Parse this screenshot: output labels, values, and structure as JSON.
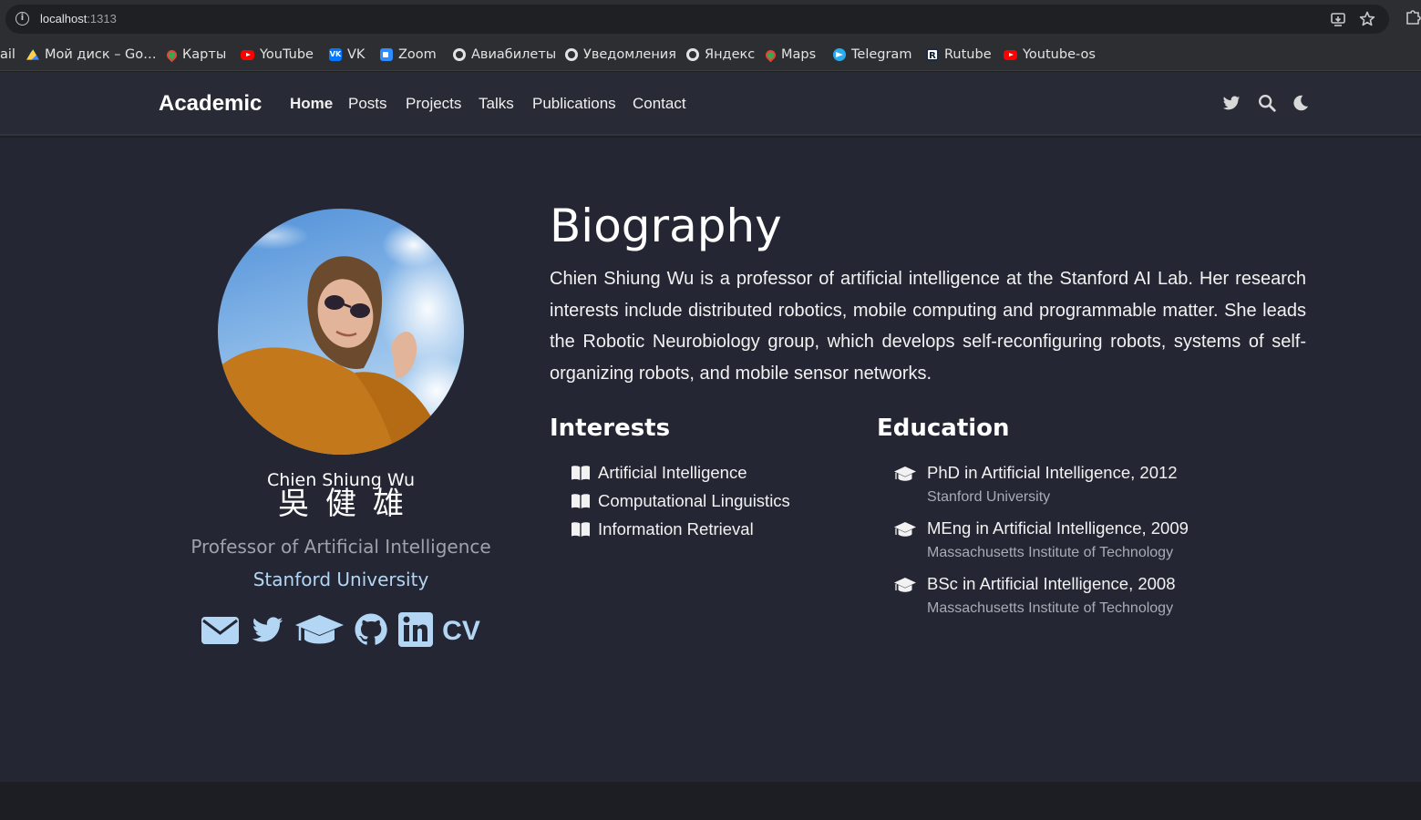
{
  "browser": {
    "url_host": "localhost",
    "url_port": ":1313",
    "bookmarks": [
      {
        "label": "ail",
        "icon": "none"
      },
      {
        "label": "Мой диск – Go…",
        "icon": "google-drive-icon"
      },
      {
        "label": "Карты",
        "icon": "google-maps-icon"
      },
      {
        "label": "YouTube",
        "icon": "youtube-icon"
      },
      {
        "label": "VK",
        "icon": "vk-icon"
      },
      {
        "label": "Zoom",
        "icon": "zoom-icon"
      },
      {
        "label": "Авиабилеты",
        "icon": "globe-icon"
      },
      {
        "label": "Уведомления",
        "icon": "globe-icon"
      },
      {
        "label": "Яндекс",
        "icon": "globe-icon"
      },
      {
        "label": "Maps",
        "icon": "google-maps-icon"
      },
      {
        "label": "Telegram",
        "icon": "telegram-icon"
      },
      {
        "label": "Rutube",
        "icon": "rutube-icon"
      },
      {
        "label": "Youtube-os",
        "icon": "youtube-icon"
      }
    ],
    "vk_glyph": "VK",
    "rutube_glyph": "R"
  },
  "nav": {
    "brand": "Academic",
    "links": [
      "Home",
      "Posts",
      "Projects",
      "Talks",
      "Publications",
      "Contact"
    ],
    "active": "Home",
    "icons": [
      "twitter-icon",
      "search-icon",
      "moon-icon"
    ]
  },
  "profile": {
    "name": "Chien Shiung Wu",
    "name_cjk": "吳健雄",
    "role": "Professor of Artificial Intelligence",
    "organization": "Stanford University",
    "social_icons": [
      "email-icon",
      "twitter-icon",
      "graduation-cap-icon",
      "github-icon",
      "linkedin-icon",
      "cv-icon"
    ],
    "cv_label": "CV"
  },
  "biography": {
    "title": "Biography",
    "text": "Chien Shiung Wu is a professor of artificial intelligence at the Stanford AI Lab. Her research interests include distributed robotics, mobile computing and programmable matter. She leads the Robotic Neurobiology group, which develops self-reconfiguring robots, systems of self-organizing robots, and mobile sensor networks."
  },
  "interests": {
    "title": "Interests",
    "items": [
      "Artificial Intelligence",
      "Computational Linguistics",
      "Information Retrieval"
    ]
  },
  "education": {
    "title": "Education",
    "items": [
      {
        "degree": "PhD in Artificial Intelligence, 2012",
        "institution": "Stanford University"
      },
      {
        "degree": "MEng in Artificial Intelligence, 2009",
        "institution": "Massachusetts Institute of Technology"
      },
      {
        "degree": "BSc in Artificial Intelligence, 2008",
        "institution": "Massachusetts Institute of Technology"
      }
    ]
  },
  "colors": {
    "page_background": "#242733",
    "navbar_background": "#282a35",
    "accent_link": "#b3d6f5",
    "muted_text": "#9ea3ab"
  }
}
